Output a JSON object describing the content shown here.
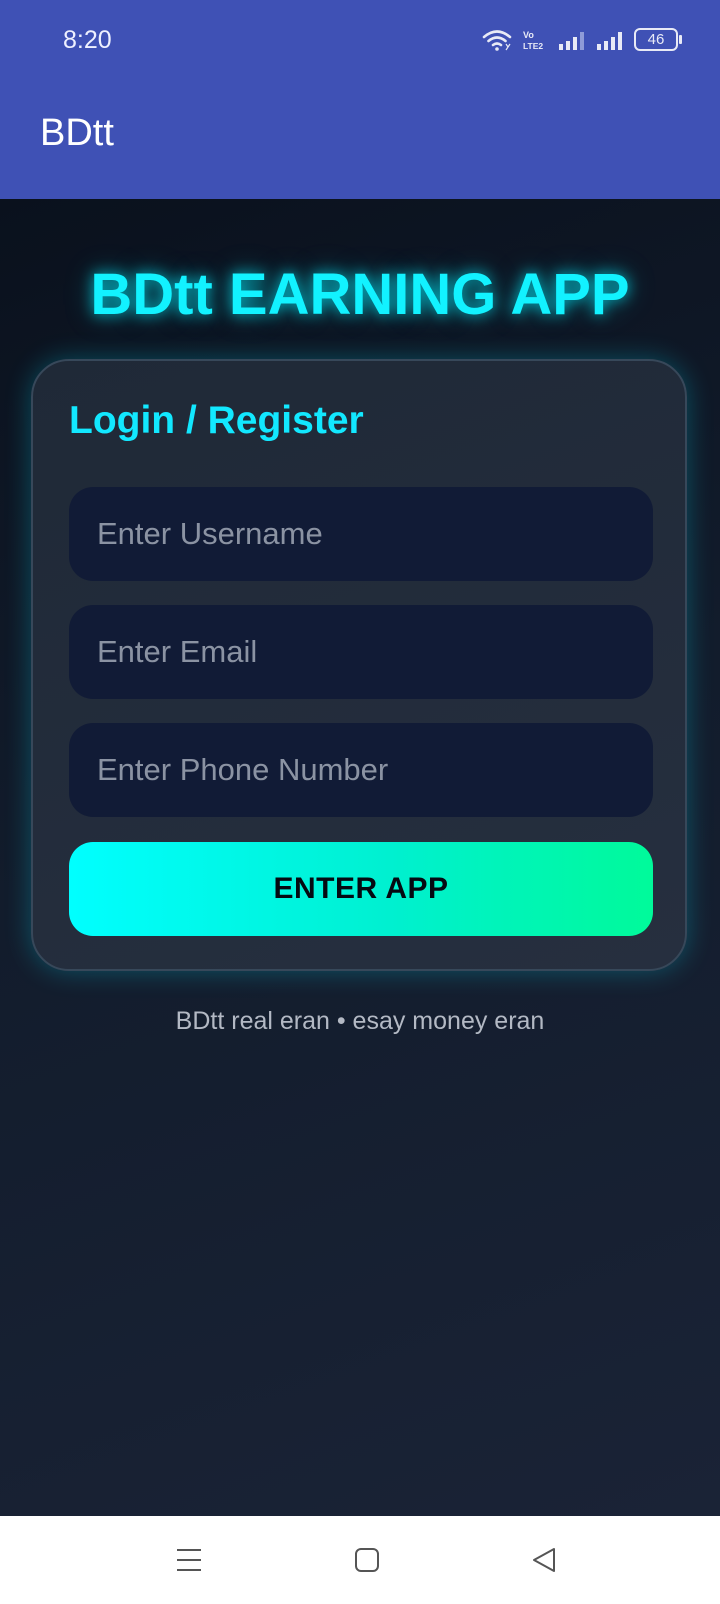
{
  "status_bar": {
    "time": "8:20",
    "battery": "46",
    "lte_label_top": "Vo",
    "lte_label_bottom": "LTE2"
  },
  "app_bar": {
    "title": "BDtt"
  },
  "hero": {
    "title": "BDtt EARNING APP"
  },
  "card": {
    "title": "Login / Register",
    "username_placeholder": "Enter Username",
    "email_placeholder": "Enter Email",
    "phone_placeholder": "Enter Phone Number",
    "button_label": "ENTER APP"
  },
  "footer": {
    "note": "BDtt real eran • esay money eran"
  },
  "colors": {
    "status_bar": "#3f51b5",
    "accent_cyan": "#12f2ff",
    "button_gradient_start": "#00ffff",
    "button_gradient_end": "#00fa9a",
    "card_bg": "#1f2937",
    "field_bg": "#111b36"
  },
  "nav_bar": {
    "icons": [
      "menu-icon",
      "home-square-icon",
      "back-triangle-icon"
    ]
  }
}
